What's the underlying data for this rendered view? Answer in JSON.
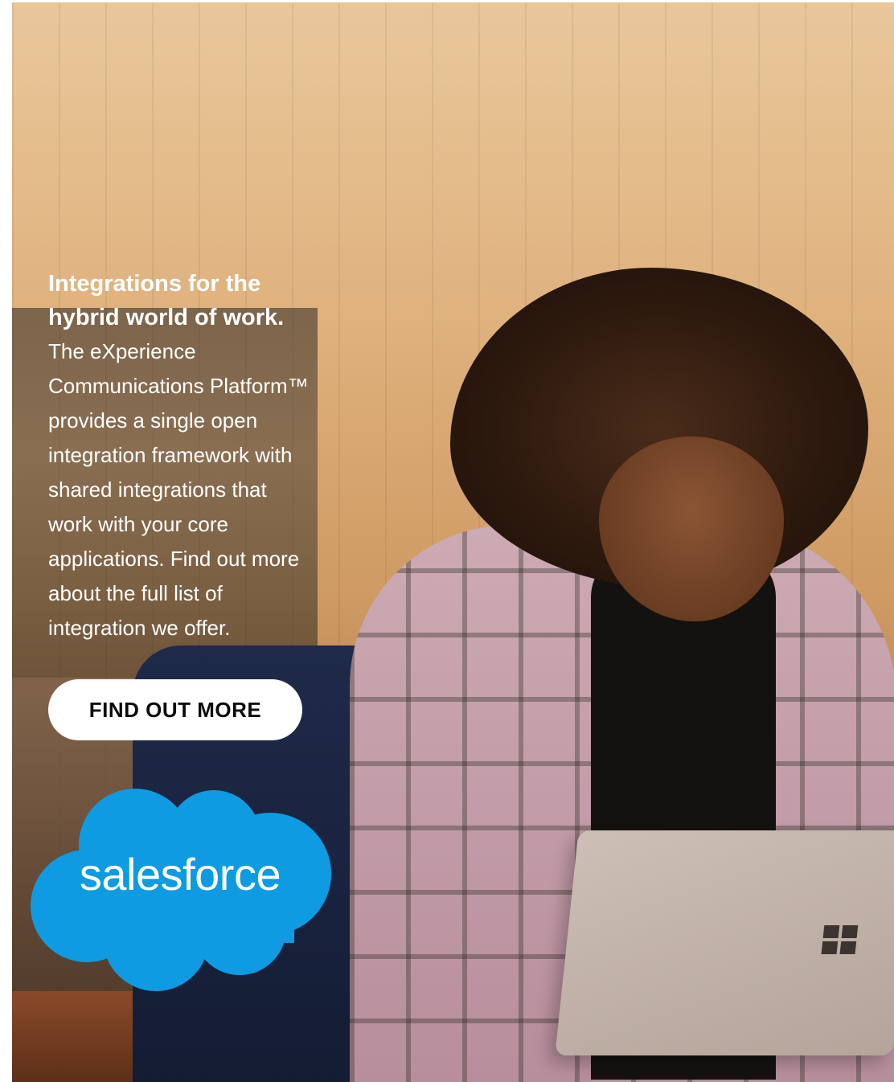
{
  "promo": {
    "headline": "Integrations for the\nhybrid world of work.",
    "body": "The eXperience\nCommunications Platform™\nprovides a single open\nintegration framework with\nshared integrations that\nwork with your core\napplications. Find out more\nabout the full list of\nintegration we offer.",
    "cta_label": "FIND OUT MORE"
  },
  "logo": {
    "wordmark": "salesforce",
    "cloud_color": "#0e9be1"
  },
  "colors": {
    "text": "#ffffff",
    "button_bg": "#ffffff",
    "button_text": "#0b0b0b"
  }
}
